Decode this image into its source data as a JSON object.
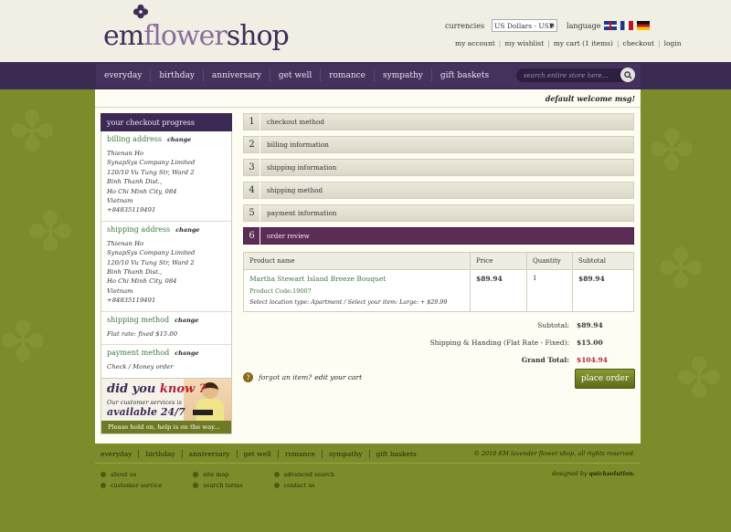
{
  "header": {
    "logo_em": "em",
    "logo_flower": "flower",
    "logo_shop": "shop",
    "currencies_label": "currencies",
    "currency_value": "US Dollars - USD",
    "language_label": "language",
    "links": [
      "my account",
      "my wishlist",
      "my cart (1 items)",
      "checkout",
      "login"
    ]
  },
  "nav": {
    "items": [
      "everyday",
      "birthday",
      "anniversary",
      "get well",
      "romance",
      "sympathy",
      "gift baskets"
    ],
    "search_placeholder": "search entire store here..."
  },
  "welcome": "default welcome msg!",
  "sidebar": {
    "title": "your checkout progress",
    "change_label": "change",
    "billing_title": "billing address",
    "billing_lines": [
      "Thienan Ho",
      "SynapSys Company Limited",
      "120/10 Vu Tung Str, Ward 2",
      "Binh Thanh Dist.,",
      "Ho Chi Minh City, 084",
      "Vietnam",
      "+84835119491"
    ],
    "shipping_title": "shipping address",
    "shipping_lines": [
      "Thienan Ho",
      "SynapSys Company Limited",
      "120/10 Vu Tung Str, Ward 2",
      "Binh Thanh Dist.,",
      "Ho Chi Minh City, 084",
      "Vietnam",
      "+84835119491"
    ],
    "method_title": "shipping method",
    "method_text": "Flat rate: fixed $15.00",
    "payment_title": "payment method",
    "payment_text": "Check / Money order"
  },
  "help": {
    "did_you": "did you",
    "know": "know ?",
    "services": "Our customer services is",
    "available": "available 24/7",
    "bar": "Please hold on, help is on the way..."
  },
  "steps": [
    {
      "num": "1",
      "label": "checkout method"
    },
    {
      "num": "2",
      "label": "billing information"
    },
    {
      "num": "3",
      "label": "shipping information"
    },
    {
      "num": "4",
      "label": "shipping method"
    },
    {
      "num": "5",
      "label": "payment information"
    },
    {
      "num": "6",
      "label": "order review"
    }
  ],
  "order": {
    "headers": [
      "Product name",
      "Price",
      "Quantity",
      "Subtotal"
    ],
    "product_name": "Martha Stewart Island Breeze Bouquet",
    "product_code": "Product Code:19007",
    "product_options": "Select location type: Apartment / Select your item: Large: + $29.99",
    "price": "$89.94",
    "qty": "1",
    "subtotal": "$89.94"
  },
  "totals": {
    "subtotal_label": "Subtotal:",
    "subtotal_value": "$89.94",
    "shipping_label": "Shipping & Handing (Flat Rate - Fixed):",
    "shipping_value": "$15.00",
    "grand_label": "Grand Total:",
    "grand_value": "$104.94"
  },
  "forgot": {
    "icon": "?",
    "text": "forgot an item?",
    "edit": "edit your cart"
  },
  "place_order": "place order",
  "footer": {
    "nav": [
      "everyday",
      "birthday",
      "anniversary",
      "get well",
      "romance",
      "sympathy",
      "gift baskets"
    ],
    "copyright": "© 2010 EM lavender flower shop. all rights reserved.",
    "col1": [
      "about us",
      "customer service"
    ],
    "col2": [
      "site map",
      "search terms"
    ],
    "col3": [
      "advanced search",
      "contact us"
    ],
    "designed_prefix": "designed by",
    "designed_by": "quicksolution."
  }
}
